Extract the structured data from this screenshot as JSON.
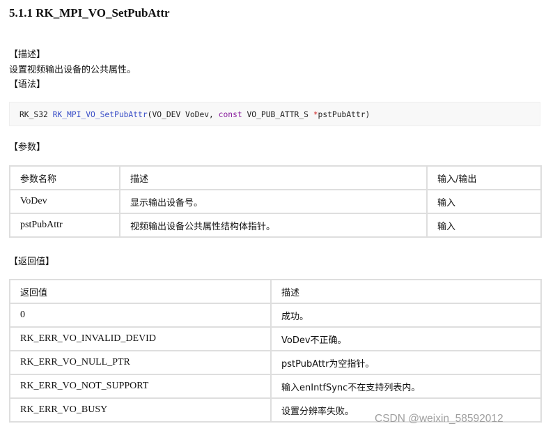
{
  "title": "5.1.1 RK_MPI_VO_SetPubAttr",
  "labels": {
    "desc": "【描述】",
    "syntax": "【语法】",
    "params": "【参数】",
    "returns": "【返回值】"
  },
  "description": "设置视频输出设备的公共属性。",
  "syntax": {
    "ret_type": "RK_S32 ",
    "func": "RK_MPI_VO_SetPubAttr",
    "open": "(VO_DEV VoDev, ",
    "kw": "const",
    "mid": " VO_PUB_ATTR_S ",
    "star": "*",
    "close": "pstPubAttr)"
  },
  "params_table": {
    "headers": [
      "参数名称",
      "描述",
      "输入/输出"
    ],
    "rows": [
      [
        "VoDev",
        "显示输出设备号。",
        "输入"
      ],
      [
        "pstPubAttr",
        "视频输出设备公共属性结构体指针。",
        "输入"
      ]
    ]
  },
  "returns_table": {
    "headers": [
      "返回值",
      "描述"
    ],
    "rows": [
      [
        "0",
        "成功。"
      ],
      [
        "RK_ERR_VO_INVALID_DEVID",
        "VoDev不正确。"
      ],
      [
        "RK_ERR_VO_NULL_PTR",
        "pstPubAttr为空指针。"
      ],
      [
        "RK_ERR_VO_NOT_SUPPORT",
        "输入enIntfSync不在支持列表内。"
      ],
      [
        "RK_ERR_VO_BUSY",
        "设置分辨率失败。"
      ]
    ]
  },
  "watermark": "CSDN @weixin_58592012"
}
